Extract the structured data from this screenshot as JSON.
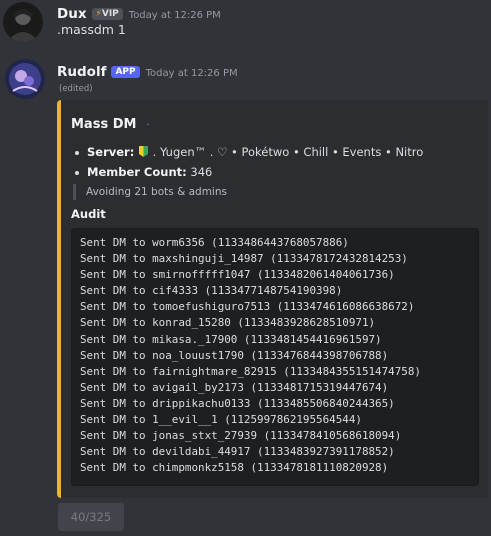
{
  "messages": {
    "first": {
      "username": "Dux",
      "badge": "VIP",
      "badge_icon": "lightning-icon",
      "timestamp": "Today at 12:26 PM",
      "content": ".massdm 1"
    },
    "second": {
      "username": "Rudolf",
      "badge": "APP",
      "timestamp": "Today at 12:26 PM",
      "edited": "(edited)"
    }
  },
  "embed": {
    "accent_color": "#f0b232",
    "title": "Mass DM",
    "title_suffix": "·",
    "server_label": "Server:",
    "server_value": ". Yugen™ . ♡ • Pokétwo • Chill • Events • Nitro",
    "member_label": "Member Count:",
    "member_value": "346",
    "note": "Avoiding 21 bots & admins",
    "audit_label": "Audit",
    "audit_lines": [
      "Sent DM to worm6356 (1133486443768057886)",
      "Sent DM to maxshinguji_14987 (1133478172432814253)",
      "Sent DM to smirnofffff1047 (1133482061404061736)",
      "Sent DM to cif4333 (1133477148754190398)",
      "Sent DM to tomoefushiguro7513 (1133474616086638672)",
      "Sent DM to konrad_15280 (1133483928628510971)",
      "Sent DM to mikasa._17900 (1133481454416961597)",
      "Sent DM to noa_louust1790 (1133476844398706788)",
      "Sent DM to fairnightmare_82915 (1133484355151474758)",
      "Sent DM to avigail_by2173 (1133481715319447674)",
      "Sent DM to drippikachu0133 (1133485506840244365)",
      "Sent DM to 1__evil__1 (1125997862195564544)",
      "Sent DM to jonas_stxt_27939 (1133478410568618094)",
      "Sent DM to devildabi_44917 (1133483927391178852)",
      "Sent DM to chimpmonkz5158 (1133478181110820928)"
    ]
  },
  "button": {
    "label": "40/325"
  }
}
